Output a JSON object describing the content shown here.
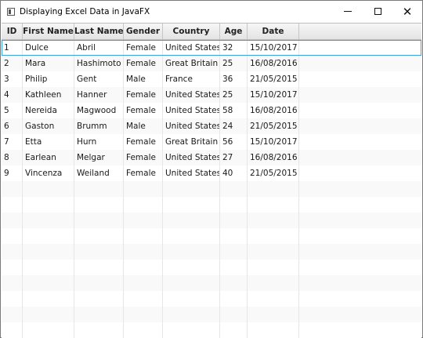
{
  "window": {
    "title": "Displaying Excel Data in JavaFX",
    "minimize_icon": "minimize-icon",
    "maximize_icon": "maximize-icon",
    "close_glyph": "✕"
  },
  "table": {
    "columns": [
      "ID",
      "First Name",
      "Last Name",
      "Gender",
      "Country",
      "Age",
      "Date"
    ],
    "rows": [
      [
        "1",
        "Dulce",
        "Abril",
        "Female",
        "United States",
        "32",
        "15/10/2017"
      ],
      [
        "2",
        "Mara",
        "Hashimoto",
        "Female",
        "Great Britain",
        "25",
        "16/08/2016"
      ],
      [
        "3",
        "Philip",
        "Gent",
        "Male",
        "France",
        "36",
        "21/05/2015"
      ],
      [
        "4",
        "Kathleen",
        "Hanner",
        "Female",
        "United States",
        "25",
        "15/10/2017"
      ],
      [
        "5",
        "Nereida",
        "Magwood",
        "Female",
        "United States",
        "58",
        "16/08/2016"
      ],
      [
        "6",
        "Gaston",
        "Brumm",
        "Male",
        "United States",
        "24",
        "21/05/2015"
      ],
      [
        "7",
        "Etta",
        "Hurn",
        "Female",
        "Great Britain",
        "56",
        "15/10/2017"
      ],
      [
        "8",
        "Earlean",
        "Melgar",
        "Female",
        "United States",
        "27",
        "16/08/2016"
      ],
      [
        "9",
        "Vincenza",
        "Weiland",
        "Female",
        "United States",
        "40",
        "21/05/2015"
      ]
    ],
    "focused_row": 0,
    "accent_color": "#39a5dc"
  }
}
